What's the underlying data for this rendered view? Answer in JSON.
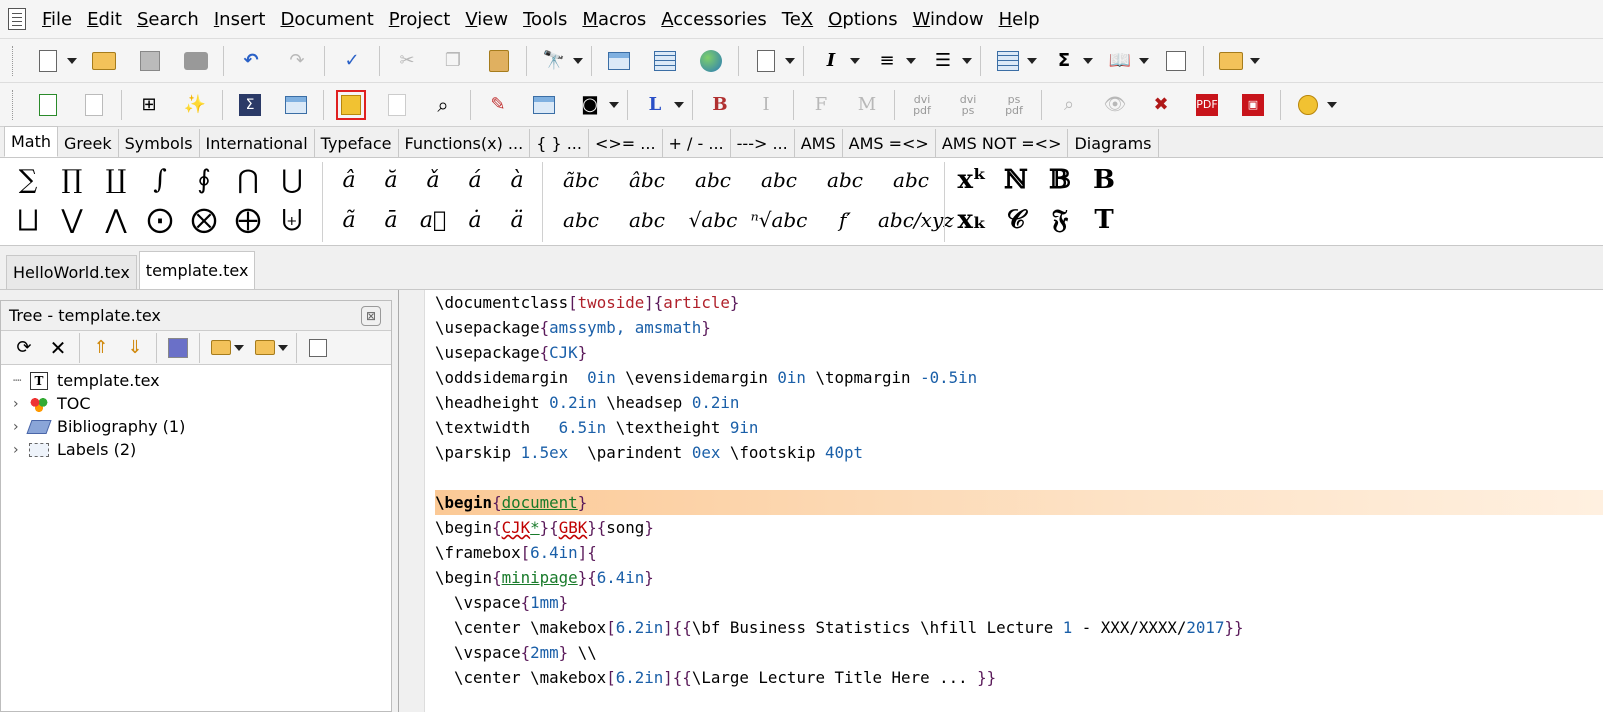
{
  "menubar": {
    "items": [
      {
        "label": "File",
        "u": "F",
        "rest": "ile"
      },
      {
        "label": "Edit",
        "u": "E",
        "rest": "dit"
      },
      {
        "label": "Search",
        "u": "S",
        "rest": "earch"
      },
      {
        "label": "Insert",
        "u": "I",
        "rest": "nsert"
      },
      {
        "label": "Document",
        "u": "D",
        "rest": "ocument"
      },
      {
        "label": "Project",
        "u": "P",
        "rest": "roject"
      },
      {
        "label": "View",
        "u": "V",
        "rest": "iew"
      },
      {
        "label": "Tools",
        "u": "T",
        "rest": "ools"
      },
      {
        "label": "Macros",
        "u": "M",
        "rest": "acros"
      },
      {
        "label": "Accessories",
        "u": "A",
        "rest": "ccessories"
      },
      {
        "label": "TeX",
        "pre": "Te",
        "u": "X",
        "rest": ""
      },
      {
        "label": "Options",
        "u": "O",
        "rest": "ptions"
      },
      {
        "label": "Window",
        "u": "W",
        "rest": "indow"
      },
      {
        "label": "Help",
        "u": "H",
        "rest": "elp"
      }
    ]
  },
  "toolbar2": {
    "l_label": "L",
    "b_label": "B",
    "i_label": "I",
    "f_label": "F",
    "m_label": "M",
    "dvipdf": "dvi pdf",
    "dvips": "dvi ps",
    "pspdf": "ps pdf",
    "adobe_label": "PDF"
  },
  "symbol_tabs": [
    "Math",
    "Greek",
    "Symbols",
    "International",
    "Typeface",
    "Functions(x) ...",
    "{ } ...",
    "<>= ...",
    "+ / - ...",
    "---> ...",
    "AMS",
    "AMS =<>",
    "AMS NOT =<>",
    "Diagrams"
  ],
  "symbols": {
    "ops_row1": [
      "∑",
      "∏",
      "∐",
      "∫",
      "∮",
      "⋂",
      "⋃"
    ],
    "ops_row2": [
      "⨆",
      "⋁",
      "⋀",
      "⨀",
      "⨂",
      "⨁",
      "⨄"
    ],
    "accents_row1": [
      "â",
      "ă",
      "ǎ",
      "á",
      "à"
    ],
    "accents_row2": [
      "ã",
      "ā",
      "a⃗",
      "ȧ",
      "ä"
    ],
    "wide_row1": [
      "ãbc",
      "âbc",
      "a͏bc",
      "abc",
      "abc",
      "abc"
    ],
    "wide_row2": [
      "abc",
      "abc",
      "√abc",
      "ⁿ√abc",
      "f′",
      "abc/xyz"
    ],
    "misc_row1": [
      "xᵏ",
      "ℕ",
      "𝔹",
      "B"
    ],
    "misc_row2": [
      "xₖ",
      "𝒞",
      "𝔉",
      "T"
    ]
  },
  "file_tabs": [
    "HelloWorld.tex",
    "template.tex"
  ],
  "tree": {
    "title": "Tree - template.tex",
    "close_label": "⊠",
    "items": [
      {
        "label": "template.tex",
        "icon": "tex-file-icon"
      },
      {
        "label": "TOC",
        "icon": "toc-icon"
      },
      {
        "label": "Bibliography (1)",
        "icon": "bibliography-icon"
      },
      {
        "label": "Labels (2)",
        "icon": "labels-icon"
      }
    ]
  },
  "editor": {
    "lines": [
      [
        [
          "kw",
          "\\documentclass"
        ],
        [
          "br",
          "["
        ],
        [
          "ar",
          "twoside"
        ],
        [
          "br",
          "]{"
        ],
        [
          "ar",
          "article"
        ],
        [
          "br",
          "}"
        ]
      ],
      [
        [
          "kw",
          "\\usepackage"
        ],
        [
          "br",
          "{"
        ],
        [
          "nm",
          "amssymb, amsmath"
        ],
        [
          "br",
          "}"
        ]
      ],
      [
        [
          "kw",
          "\\usepackage"
        ],
        [
          "br",
          "{"
        ],
        [
          "nm",
          "CJK"
        ],
        [
          "br",
          "}"
        ]
      ],
      [
        [
          "kw",
          "\\oddsidemargin  "
        ],
        [
          "nm",
          "0in"
        ],
        [
          "kw",
          " \\evensidemargin "
        ],
        [
          "nm",
          "0in"
        ],
        [
          "kw",
          " \\topmargin "
        ],
        [
          "nm",
          "-0.5in"
        ]
      ],
      [
        [
          "kw",
          "\\headheight "
        ],
        [
          "nm",
          "0.2in"
        ],
        [
          "kw",
          " \\headsep "
        ],
        [
          "nm",
          "0.2in"
        ]
      ],
      [
        [
          "kw",
          "\\textwidth   "
        ],
        [
          "nm",
          "6.5in"
        ],
        [
          "kw",
          " \\textheight "
        ],
        [
          "nm",
          "9in"
        ]
      ],
      [
        [
          "kw",
          "\\parskip "
        ],
        [
          "nm",
          "1.5ex"
        ],
        [
          "kw",
          "  \\parindent "
        ],
        [
          "nm",
          "0ex"
        ],
        [
          "kw",
          " \\footskip "
        ],
        [
          "nm",
          "40pt"
        ]
      ],
      [],
      [
        [
          "kwb",
          "\\begin"
        ],
        [
          "br",
          "{"
        ],
        [
          "en",
          "document"
        ],
        [
          "br",
          "}"
        ]
      ],
      [
        [
          "kw",
          "\\begin"
        ],
        [
          "br",
          "{"
        ],
        [
          "sq",
          "CJK"
        ],
        [
          "en",
          "*"
        ],
        [
          "br",
          "}{"
        ],
        [
          "sq",
          "GBK"
        ],
        [
          "br",
          "}{"
        ],
        [
          "kw",
          "song"
        ],
        [
          "br",
          "}"
        ]
      ],
      [
        [
          "kw",
          "\\framebox"
        ],
        [
          "br",
          "["
        ],
        [
          "nm",
          "6.4in"
        ],
        [
          "br",
          "]{"
        ]
      ],
      [
        [
          "kw",
          "\\begin"
        ],
        [
          "br",
          "{"
        ],
        [
          "en",
          "minipage"
        ],
        [
          "br",
          "}{"
        ],
        [
          "nm",
          "6.4in"
        ],
        [
          "br",
          "}"
        ]
      ],
      [
        [
          "kw",
          "  \\vspace"
        ],
        [
          "br",
          "{"
        ],
        [
          "nm",
          "1mm"
        ],
        [
          "br",
          "}"
        ]
      ],
      [
        [
          "kw",
          "  \\center \\makebox"
        ],
        [
          "br",
          "["
        ],
        [
          "nm",
          "6.2in"
        ],
        [
          "br",
          "]{{"
        ],
        [
          "kw",
          "\\bf Business Statistics \\hfill Lecture "
        ],
        [
          "nm",
          "1"
        ],
        [
          "kw",
          " - XXX/XXXX/"
        ],
        [
          "nm",
          "2017"
        ],
        [
          "br",
          "}}"
        ]
      ],
      [
        [
          "kw",
          "  \\vspace"
        ],
        [
          "br",
          "{"
        ],
        [
          "nm",
          "2mm"
        ],
        [
          "br",
          "}"
        ],
        [
          "kw",
          " \\\\"
        ]
      ],
      [
        [
          "kw",
          "  \\center \\makebox"
        ],
        [
          "br",
          "["
        ],
        [
          "nm",
          "6.2in"
        ],
        [
          "br",
          "]{{"
        ],
        [
          "kw",
          "\\Large Lecture Title Here ... "
        ],
        [
          "br",
          "}}"
        ]
      ]
    ]
  }
}
